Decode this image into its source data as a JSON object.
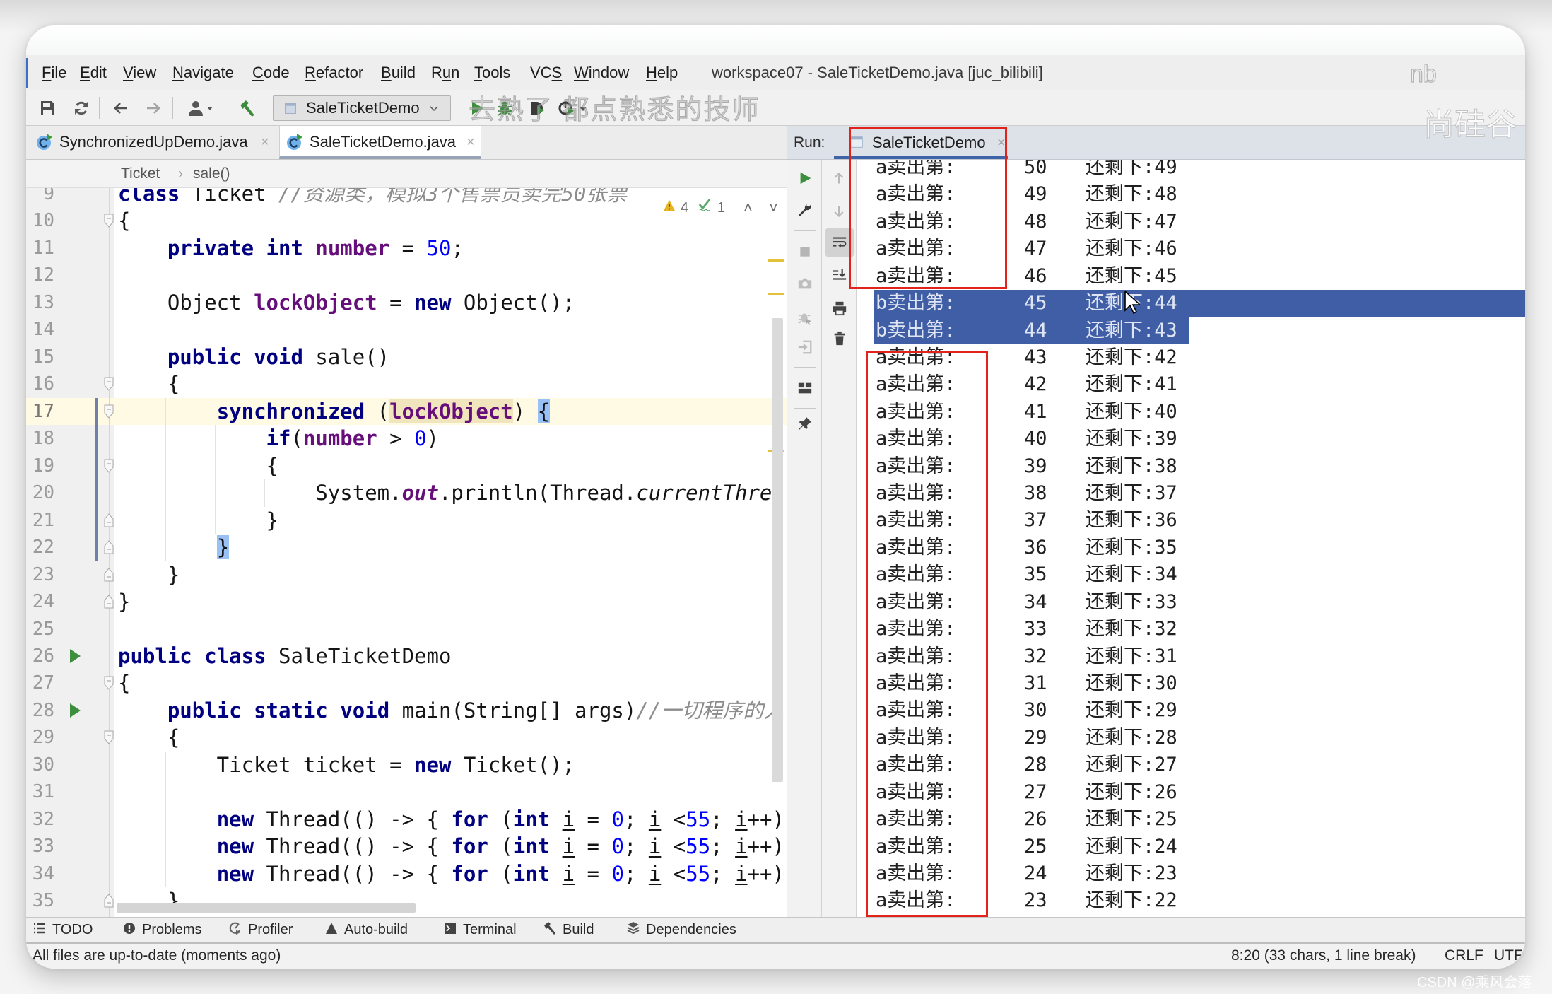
{
  "window": {
    "title": "workspace07 - SaleTicketDemo.java [juc_bilibili]"
  },
  "menu": {
    "items": [
      {
        "label": "File",
        "mnemonic": 0
      },
      {
        "label": "Edit",
        "mnemonic": 0
      },
      {
        "label": "View",
        "mnemonic": 0
      },
      {
        "label": "Navigate",
        "mnemonic": 0
      },
      {
        "label": "Code",
        "mnemonic": 0
      },
      {
        "label": "Refactor",
        "mnemonic": 0
      },
      {
        "label": "Build",
        "mnemonic": 0
      },
      {
        "label": "Run",
        "mnemonic": 1
      },
      {
        "label": "Tools",
        "mnemonic": 0
      },
      {
        "label": "VCS",
        "mnemonic": 2
      },
      {
        "label": "Window",
        "mnemonic": 0
      },
      {
        "label": "Help",
        "mnemonic": 0
      }
    ]
  },
  "toolbar": {
    "run_config": "SaleTicketDemo",
    "icons": [
      "save-icon",
      "sync-icon",
      "back-icon",
      "forward-icon",
      "user-icon",
      "build-hammer-icon",
      "run-icon",
      "debug-icon",
      "coverage-icon",
      "profile-icon"
    ]
  },
  "editor": {
    "tabs": [
      {
        "label": "SynchronizedUpDemo.java",
        "active": false,
        "close": "×"
      },
      {
        "label": "SaleTicketDemo.java",
        "active": true,
        "close": "×"
      }
    ],
    "breadcrumb": [
      "Ticket",
      "›",
      "sale()"
    ],
    "inspection": {
      "warnings": "4",
      "weak_warnings": "1",
      "prev": "˄",
      "next": "˅"
    },
    "first_visible_line": 9,
    "caret_line": 17,
    "changed_range": [
      17,
      22
    ],
    "run_gutter_lines": [
      26,
      28
    ],
    "fold_open_lines": [
      10,
      16,
      17,
      19,
      27,
      29
    ],
    "fold_close_lines": [
      21,
      22,
      23,
      24,
      35
    ],
    "lines": [
      {
        "n": 9,
        "tokens": [
          [
            "class",
            "kw"
          ],
          [
            " Ticket ",
            "plain"
          ],
          [
            "//资源类，模拟3个售票员卖完50张票",
            "cmt"
          ]
        ]
      },
      {
        "n": 10,
        "tokens": [
          [
            "{",
            "plain"
          ]
        ]
      },
      {
        "n": 11,
        "tokens": [
          [
            "    ",
            "plain"
          ],
          [
            "private",
            "kw"
          ],
          [
            " ",
            "plain"
          ],
          [
            "int",
            "kw"
          ],
          [
            " ",
            "plain"
          ],
          [
            "number",
            "field"
          ],
          [
            " = ",
            "plain"
          ],
          [
            "50",
            "num"
          ],
          [
            ";",
            "plain"
          ]
        ]
      },
      {
        "n": 12,
        "tokens": []
      },
      {
        "n": 13,
        "tokens": [
          [
            "    Object ",
            "plain"
          ],
          [
            "lockObject",
            "field"
          ],
          [
            " = ",
            "plain"
          ],
          [
            "new",
            "kw"
          ],
          [
            " Object();",
            "plain"
          ]
        ]
      },
      {
        "n": 14,
        "tokens": []
      },
      {
        "n": 15,
        "tokens": [
          [
            "    ",
            "plain"
          ],
          [
            "public",
            "kw"
          ],
          [
            " ",
            "plain"
          ],
          [
            "void",
            "kw"
          ],
          [
            " sale()",
            "plain"
          ]
        ]
      },
      {
        "n": 16,
        "tokens": [
          [
            "    {",
            "plain"
          ]
        ]
      },
      {
        "n": 17,
        "tokens": [
          [
            "        ",
            "plain"
          ],
          [
            "synchronized",
            "kw"
          ],
          [
            " (",
            "plain"
          ],
          [
            "lockObject",
            "field-hl"
          ],
          [
            ") ",
            "plain"
          ],
          [
            "{",
            "brace-hl"
          ]
        ]
      },
      {
        "n": 18,
        "tokens": [
          [
            "            ",
            "plain"
          ],
          [
            "if",
            "kw"
          ],
          [
            "(",
            "plain"
          ],
          [
            "number",
            "field"
          ],
          [
            " > ",
            "plain"
          ],
          [
            "0",
            "num"
          ],
          [
            ")",
            "plain"
          ]
        ]
      },
      {
        "n": 19,
        "tokens": [
          [
            "            {",
            "plain"
          ]
        ]
      },
      {
        "n": 20,
        "tokens": [
          [
            "                System.",
            "plain"
          ],
          [
            "out",
            "static"
          ],
          [
            ".println(Thread.",
            "plain"
          ],
          [
            "currentThrea",
            "ital"
          ]
        ]
      },
      {
        "n": 21,
        "tokens": [
          [
            "            }",
            "plain"
          ]
        ]
      },
      {
        "n": 22,
        "tokens": [
          [
            "        ",
            "plain"
          ],
          [
            "}",
            "brace-hl"
          ]
        ]
      },
      {
        "n": 23,
        "tokens": [
          [
            "    }",
            "plain"
          ]
        ]
      },
      {
        "n": 24,
        "tokens": [
          [
            "}",
            "plain"
          ]
        ]
      },
      {
        "n": 25,
        "tokens": []
      },
      {
        "n": 26,
        "tokens": [
          [
            "public",
            "kw"
          ],
          [
            " ",
            "plain"
          ],
          [
            "class",
            "kw"
          ],
          [
            " SaleTicketDemo",
            "plain"
          ]
        ]
      },
      {
        "n": 27,
        "tokens": [
          [
            "{",
            "plain"
          ]
        ]
      },
      {
        "n": 28,
        "tokens": [
          [
            "    ",
            "plain"
          ],
          [
            "public",
            "kw"
          ],
          [
            " ",
            "plain"
          ],
          [
            "static",
            "kw"
          ],
          [
            " ",
            "plain"
          ],
          [
            "void",
            "kw"
          ],
          [
            " main(String[] args)",
            "plain"
          ],
          [
            "//一切程序的入",
            "cmt"
          ]
        ]
      },
      {
        "n": 29,
        "tokens": [
          [
            "    {",
            "plain"
          ]
        ]
      },
      {
        "n": 30,
        "tokens": [
          [
            "        Ticket ticket = ",
            "plain"
          ],
          [
            "new",
            "kw"
          ],
          [
            " Ticket();",
            "plain"
          ]
        ]
      },
      {
        "n": 31,
        "tokens": []
      },
      {
        "n": 32,
        "tokens": [
          [
            "        ",
            "plain"
          ],
          [
            "new",
            "kw"
          ],
          [
            " Thread(() -> { ",
            "plain"
          ],
          [
            "for",
            "kw"
          ],
          [
            " (",
            "plain"
          ],
          [
            "int",
            "kw"
          ],
          [
            " ",
            "plain"
          ],
          [
            "i",
            "var"
          ],
          [
            " = ",
            "plain"
          ],
          [
            "0",
            "num"
          ],
          [
            "; ",
            "plain"
          ],
          [
            "i",
            "var"
          ],
          [
            " <",
            "plain"
          ],
          [
            "55",
            "num"
          ],
          [
            "; ",
            "plain"
          ],
          [
            "i",
            "var"
          ],
          [
            "++)",
            "plain"
          ]
        ]
      },
      {
        "n": 33,
        "tokens": [
          [
            "        ",
            "plain"
          ],
          [
            "new",
            "kw"
          ],
          [
            " Thread(() -> { ",
            "plain"
          ],
          [
            "for",
            "kw"
          ],
          [
            " (",
            "plain"
          ],
          [
            "int",
            "kw"
          ],
          [
            " ",
            "plain"
          ],
          [
            "i",
            "var"
          ],
          [
            " = ",
            "plain"
          ],
          [
            "0",
            "num"
          ],
          [
            "; ",
            "plain"
          ],
          [
            "i",
            "var"
          ],
          [
            " <",
            "plain"
          ],
          [
            "55",
            "num"
          ],
          [
            "; ",
            "plain"
          ],
          [
            "i",
            "var"
          ],
          [
            "++)",
            "plain"
          ]
        ]
      },
      {
        "n": 34,
        "tokens": [
          [
            "        ",
            "plain"
          ],
          [
            "new",
            "kw"
          ],
          [
            " Thread(() -> { ",
            "plain"
          ],
          [
            "for",
            "kw"
          ],
          [
            " (",
            "plain"
          ],
          [
            "int",
            "kw"
          ],
          [
            " ",
            "plain"
          ],
          [
            "i",
            "var"
          ],
          [
            " = ",
            "plain"
          ],
          [
            "0",
            "num"
          ],
          [
            "; ",
            "plain"
          ],
          [
            "i",
            "var"
          ],
          [
            " <",
            "plain"
          ],
          [
            "55",
            "num"
          ],
          [
            "; ",
            "plain"
          ],
          [
            "i",
            "var"
          ],
          [
            "++)",
            "plain"
          ]
        ]
      },
      {
        "n": 35,
        "tokens": [
          [
            "    }",
            "plain"
          ]
        ]
      }
    ]
  },
  "run": {
    "label": "Run:",
    "tab": "SaleTicketDemo",
    "tab_close": "×",
    "console": {
      "rows": [
        {
          "thread": "a",
          "label": "卖出第:",
          "sold": "50",
          "remaining_label": "还剩下:",
          "remaining": "49",
          "selection": "none"
        },
        {
          "thread": "a",
          "label": "卖出第:",
          "sold": "49",
          "remaining_label": "还剩下:",
          "remaining": "48",
          "selection": "none"
        },
        {
          "thread": "a",
          "label": "卖出第:",
          "sold": "48",
          "remaining_label": "还剩下:",
          "remaining": "47",
          "selection": "none"
        },
        {
          "thread": "a",
          "label": "卖出第:",
          "sold": "47",
          "remaining_label": "还剩下:",
          "remaining": "46",
          "selection": "none"
        },
        {
          "thread": "a",
          "label": "卖出第:",
          "sold": "46",
          "remaining_label": "还剩下:",
          "remaining": "45",
          "selection": "none"
        },
        {
          "thread": "b",
          "label": "卖出第:",
          "sold": "45",
          "remaining_label": "还剩下:",
          "remaining": "44",
          "selection": "full"
        },
        {
          "thread": "b",
          "label": "卖出第:",
          "sold": "44",
          "remaining_label": "还剩下:",
          "remaining": "43",
          "selection": "partial"
        },
        {
          "thread": "a",
          "label": "卖出第:",
          "sold": "43",
          "remaining_label": "还剩下:",
          "remaining": "42",
          "selection": "none"
        },
        {
          "thread": "a",
          "label": "卖出第:",
          "sold": "42",
          "remaining_label": "还剩下:",
          "remaining": "41",
          "selection": "none"
        },
        {
          "thread": "a",
          "label": "卖出第:",
          "sold": "41",
          "remaining_label": "还剩下:",
          "remaining": "40",
          "selection": "none"
        },
        {
          "thread": "a",
          "label": "卖出第:",
          "sold": "40",
          "remaining_label": "还剩下:",
          "remaining": "39",
          "selection": "none"
        },
        {
          "thread": "a",
          "label": "卖出第:",
          "sold": "39",
          "remaining_label": "还剩下:",
          "remaining": "38",
          "selection": "none"
        },
        {
          "thread": "a",
          "label": "卖出第:",
          "sold": "38",
          "remaining_label": "还剩下:",
          "remaining": "37",
          "selection": "none"
        },
        {
          "thread": "a",
          "label": "卖出第:",
          "sold": "37",
          "remaining_label": "还剩下:",
          "remaining": "36",
          "selection": "none"
        },
        {
          "thread": "a",
          "label": "卖出第:",
          "sold": "36",
          "remaining_label": "还剩下:",
          "remaining": "35",
          "selection": "none"
        },
        {
          "thread": "a",
          "label": "卖出第:",
          "sold": "35",
          "remaining_label": "还剩下:",
          "remaining": "34",
          "selection": "none"
        },
        {
          "thread": "a",
          "label": "卖出第:",
          "sold": "34",
          "remaining_label": "还剩下:",
          "remaining": "33",
          "selection": "none"
        },
        {
          "thread": "a",
          "label": "卖出第:",
          "sold": "33",
          "remaining_label": "还剩下:",
          "remaining": "32",
          "selection": "none"
        },
        {
          "thread": "a",
          "label": "卖出第:",
          "sold": "32",
          "remaining_label": "还剩下:",
          "remaining": "31",
          "selection": "none"
        },
        {
          "thread": "a",
          "label": "卖出第:",
          "sold": "31",
          "remaining_label": "还剩下:",
          "remaining": "30",
          "selection": "none"
        },
        {
          "thread": "a",
          "label": "卖出第:",
          "sold": "30",
          "remaining_label": "还剩下:",
          "remaining": "29",
          "selection": "none"
        },
        {
          "thread": "a",
          "label": "卖出第:",
          "sold": "29",
          "remaining_label": "还剩下:",
          "remaining": "28",
          "selection": "none"
        },
        {
          "thread": "a",
          "label": "卖出第:",
          "sold": "28",
          "remaining_label": "还剩下:",
          "remaining": "27",
          "selection": "none"
        },
        {
          "thread": "a",
          "label": "卖出第:",
          "sold": "27",
          "remaining_label": "还剩下:",
          "remaining": "26",
          "selection": "none"
        },
        {
          "thread": "a",
          "label": "卖出第:",
          "sold": "26",
          "remaining_label": "还剩下:",
          "remaining": "25",
          "selection": "none"
        },
        {
          "thread": "a",
          "label": "卖出第:",
          "sold": "25",
          "remaining_label": "还剩下:",
          "remaining": "24",
          "selection": "none"
        },
        {
          "thread": "a",
          "label": "卖出第:",
          "sold": "24",
          "remaining_label": "还剩下:",
          "remaining": "23",
          "selection": "none"
        },
        {
          "thread": "a",
          "label": "卖出第:",
          "sold": "23",
          "remaining_label": "还剩下:",
          "remaining": "22",
          "selection": "none"
        }
      ]
    },
    "left_toolbar": [
      "rerun-icon",
      "settings-wrench-icon",
      "stop-icon",
      "snapshot-camera-icon",
      "debug-attach-icon",
      "restore-layout-icon",
      "layout-icon",
      "pin-icon"
    ],
    "right_toolbar": [
      "scroll-up-icon",
      "scroll-down-icon",
      "soft-wrap-icon",
      "scroll-to-end-icon",
      "print-icon",
      "clear-trash-icon"
    ]
  },
  "bottom_tools": [
    {
      "icon": "todo-list-icon",
      "label": "TODO"
    },
    {
      "icon": "problems-icon",
      "label": "Problems"
    },
    {
      "icon": "profiler-icon",
      "label": "Profiler"
    },
    {
      "icon": "auto-build-icon",
      "label": "Auto-build"
    },
    {
      "icon": "terminal-icon",
      "label": "Terminal"
    },
    {
      "icon": "build-hammer-icon",
      "label": "Build"
    },
    {
      "icon": "dependencies-icon",
      "label": "Dependencies"
    }
  ],
  "status": {
    "message": "All files are up-to-date (moments ago)",
    "position": "8:20 (33 chars, 1 line break)",
    "line_separator": "CRLF",
    "encoding": "UTF"
  },
  "overlays": {
    "subtitle": "去熟了 都点熟悉的技师",
    "watermark_nb": "nb",
    "watermark_brand": "尚硅谷",
    "watermark_csdn": "CSDN @乘风会落"
  },
  "colors": {
    "keyword": "#000080",
    "field": "#660e7a",
    "number": "#0000ff",
    "comment": "#8c8c8c",
    "caret_row": "#fffae3",
    "selection": "#3f5ea5",
    "annotation_box": "#e1231b",
    "run_green": "#3d8f3d"
  }
}
